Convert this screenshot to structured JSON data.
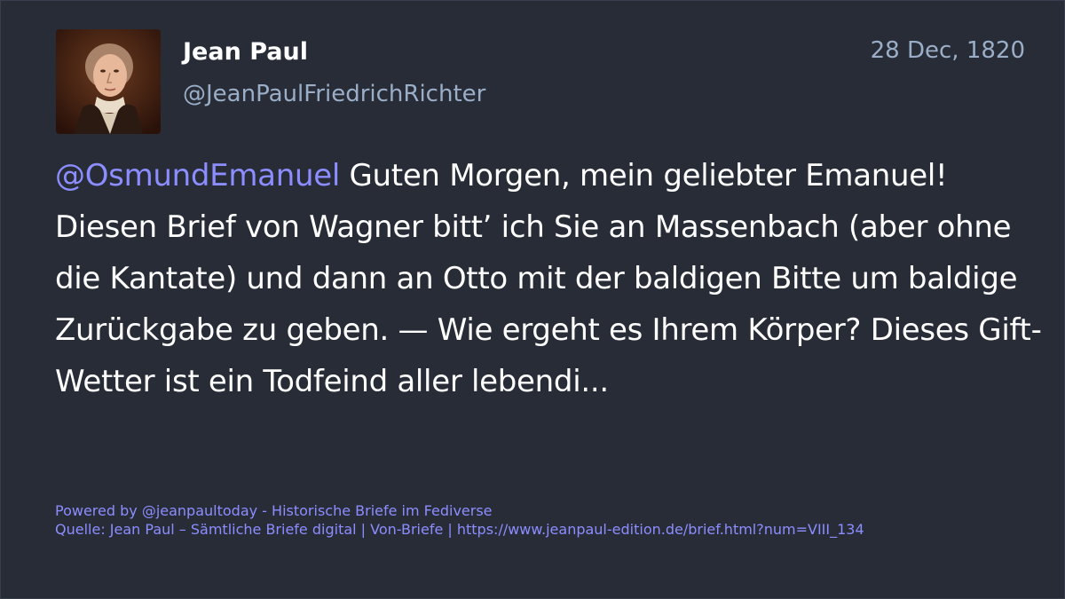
{
  "post": {
    "display_name": "Jean Paul",
    "handle": "@JeanPaulFriedrichRichter",
    "date": "28 Dec, 1820",
    "mention": "@OsmundEmanuel",
    "body": " Guten Morgen, mein geliebter Emanuel! Diesen Brief von Wagner bitt’ ich Sie an Massenbach (aber ohne die Kantate) und dann an Otto mit der baldigen Bitte um baldige Zurückgabe zu geben. — Wie ergeht es Ihrem Körper? Dieses Gift-Wetter ist ein Todfeind aller lebendi..."
  },
  "footer": {
    "powered_by": "Powered by @jeanpaultoday - Historische Briefe im Fediverse",
    "source": "Quelle: Jean Paul – Sämtliche Briefe digital | Von-Briefe | https://www.jeanpaul-edition.de/brief.html?num=VIII_134"
  },
  "colors": {
    "background": "#282c37",
    "name": "#ffffff",
    "secondary": "#9baec8",
    "accent": "#8c8dff"
  }
}
